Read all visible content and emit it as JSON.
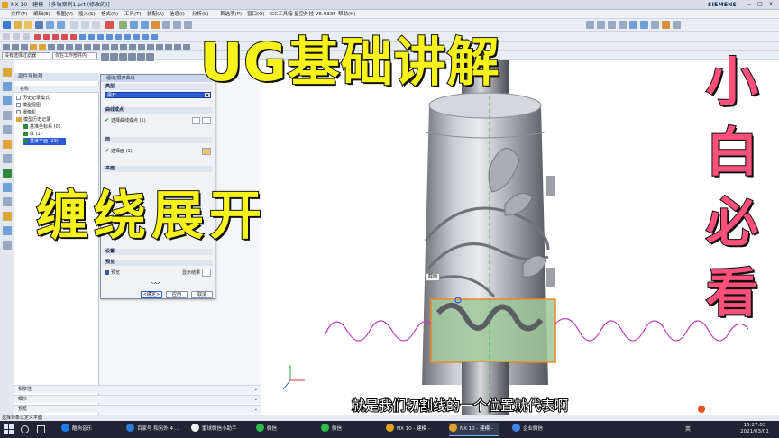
{
  "window": {
    "title": "NX 10 - 建模 - [多轴案例1.prt  (修改的)]",
    "brand": "SIEMENS",
    "controls": [
      "–",
      "□",
      "×"
    ]
  },
  "menubar": {
    "items": [
      "文件(F)",
      "编辑(E)",
      "视图(V)",
      "插入(S)",
      "格式(R)",
      "工具(T)",
      "装配(A)",
      "信息(I)",
      "分析(L)",
      "首选项(P)",
      "窗口(O)",
      "GC工具箱",
      "星空外挂 V6.933F",
      "帮助(H)"
    ]
  },
  "toolbar": {
    "filter_label": "没有选择过滤器",
    "scope_label": "仅在工作部件内"
  },
  "navigator": {
    "title": "部件导航器",
    "column_header": "名称",
    "rows": [
      {
        "label": "历史记录模式",
        "kind": "box"
      },
      {
        "label": "模型视图",
        "kind": "box"
      },
      {
        "label": "摄像机",
        "kind": "box"
      },
      {
        "label": "模型历史记录",
        "kind": "folder"
      },
      {
        "label": "基准坐标系 (0)",
        "kind": "check"
      },
      {
        "label": "体 (1)",
        "kind": "check"
      },
      {
        "label": "基准平面 (23)",
        "kind": "check"
      }
    ],
    "bottom_sections": [
      "相依性",
      "细节",
      "预览"
    ]
  },
  "dialog": {
    "title": "缠绕/展开曲线",
    "sections": {
      "type": "类型",
      "curve": "曲线或点",
      "face": "面",
      "plane": "平面",
      "settings": "设置",
      "preview": "预览"
    },
    "type_value": "展开",
    "select_curve": "选择曲线或点 (1)",
    "select_face": "选择面 (1)",
    "preview_label": "预览",
    "show_result": "显示结果",
    "buttons": {
      "ok": "<确定>",
      "apply": "应用",
      "cancel": "取消"
    }
  },
  "graphics": {
    "float_label": "截面"
  },
  "overlays": {
    "title": "UG基础讲解",
    "subtitle_big": "缠绕展开",
    "side_chars": [
      "小",
      "白",
      "必",
      "看"
    ],
    "caption": "就是我们切割线的一个位置就代表啊"
  },
  "statusbar": {
    "text": "选择对象以定义平面"
  },
  "taskbar": {
    "items": [
      {
        "label": "酷狗音乐",
        "color": "#1e7cf2"
      },
      {
        "label": "百家号 和另外 4 ...",
        "color": "#2d7de0"
      },
      {
        "label": "雷球微信小助手",
        "color": "#f0f0f0"
      },
      {
        "label": "微信",
        "color": "#2dbb4e"
      },
      {
        "label": "微信",
        "color": "#2dbb4e"
      },
      {
        "label": "NX 10 - 建模 -",
        "color": "#e2a020"
      },
      {
        "label": "NX 10 - 建模 -",
        "color": "#e2a020"
      },
      {
        "label": "企业微信",
        "color": "#3a86e8"
      }
    ],
    "tray_lang": "英",
    "time": "15:27:03",
    "date": "2021/03/01"
  },
  "colors": {
    "accent_blue": "#2a5bd7",
    "overlay_yellow": "#f7f21a",
    "overlay_pink": "#ff4f7b",
    "curve_magenta": "#c23bbd",
    "select_orange": "#e88a2a"
  }
}
